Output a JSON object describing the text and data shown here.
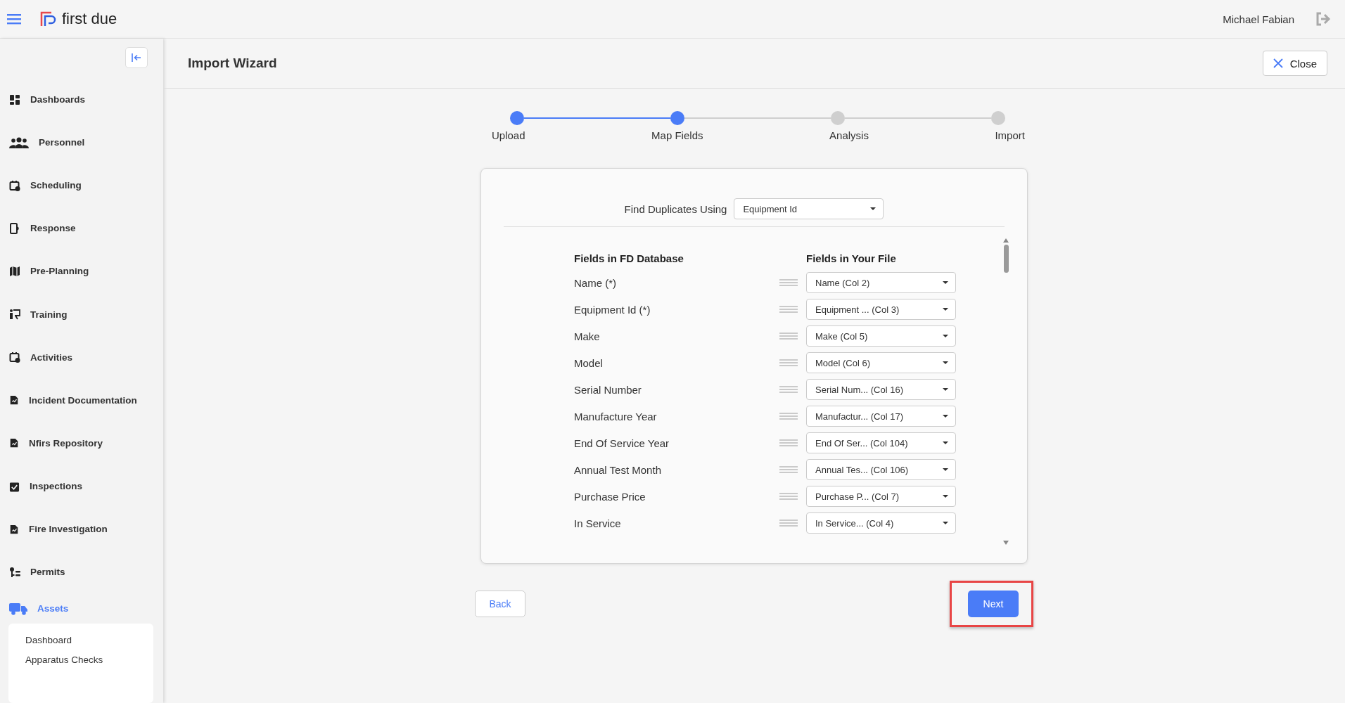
{
  "header": {
    "brand": "first due",
    "user": "Michael Fabian"
  },
  "sidebar": {
    "items": [
      {
        "label": "Dashboards",
        "selected": false
      },
      {
        "label": "Personnel",
        "selected": false
      },
      {
        "label": "Scheduling",
        "selected": false
      },
      {
        "label": "Response",
        "selected": false
      },
      {
        "label": "Pre-Planning",
        "selected": false
      },
      {
        "label": "Training",
        "selected": false
      },
      {
        "label": "Activities",
        "selected": false
      },
      {
        "label": "Incident Documentation",
        "selected": false
      },
      {
        "label": "Nfirs Repository",
        "selected": false
      },
      {
        "label": "Inspections",
        "selected": false
      },
      {
        "label": "Fire Investigation",
        "selected": false
      },
      {
        "label": "Permits",
        "selected": false
      },
      {
        "label": "Assets",
        "selected": true,
        "children": [
          {
            "label": "Dashboard"
          },
          {
            "label": "Apparatus Checks"
          }
        ]
      }
    ]
  },
  "page": {
    "title": "Import Wizard",
    "close_button": "Close"
  },
  "steps": [
    {
      "label": "Upload",
      "done": true
    },
    {
      "label": "Map Fields",
      "done": true
    },
    {
      "label": "Analysis",
      "done": false
    },
    {
      "label": "Import",
      "done": false
    }
  ],
  "duplicates": {
    "label": "Find Duplicates Using",
    "value": "Equipment Id"
  },
  "mapping": {
    "columns": [
      "Fields in FD Database",
      "Fields in Your File"
    ],
    "rows": [
      {
        "field": "Name (*)",
        "value": "Name (Col 2)"
      },
      {
        "field": "Equipment Id (*)",
        "value": "Equipment ... (Col 3)"
      },
      {
        "field": "Make",
        "value": "Make (Col 5)"
      },
      {
        "field": "Model",
        "value": "Model (Col 6)"
      },
      {
        "field": "Serial Number",
        "value": "Serial Num... (Col 16)"
      },
      {
        "field": "Manufacture Year",
        "value": "Manufactur... (Col 17)"
      },
      {
        "field": "End Of Service Year",
        "value": "End Of Ser... (Col 104)"
      },
      {
        "field": "Annual Test Month",
        "value": "Annual Tes... (Col 106)"
      },
      {
        "field": "Purchase Price",
        "value": "Purchase P... (Col 7)"
      },
      {
        "field": "In Service",
        "value": "In Service... (Col 4)"
      }
    ]
  },
  "buttons": {
    "back": "Back",
    "next": "Next",
    "next_highlighted": true
  }
}
